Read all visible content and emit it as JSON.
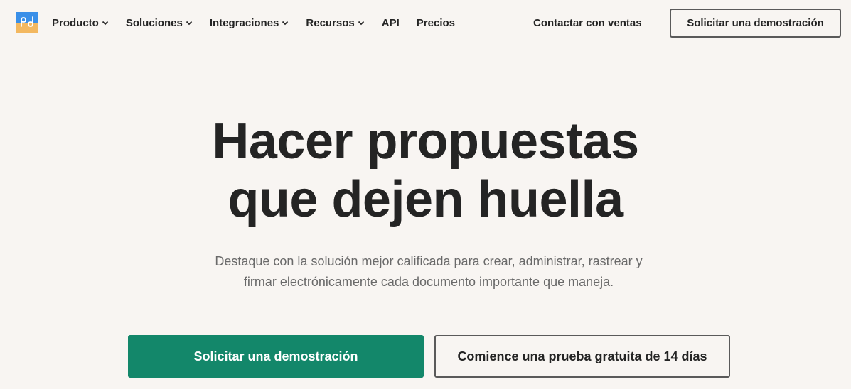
{
  "header": {
    "logo_icon": "pandadoc-logo",
    "nav": [
      {
        "label": "Producto",
        "dropdown": true
      },
      {
        "label": "Soluciones",
        "dropdown": true
      },
      {
        "label": "Integraciones",
        "dropdown": true
      },
      {
        "label": "Recursos",
        "dropdown": true
      },
      {
        "label": "API",
        "dropdown": false
      },
      {
        "label": "Precios",
        "dropdown": false
      }
    ],
    "contact_label": "Contactar con ventas",
    "demo_button_label": "Solicitar una demostración"
  },
  "hero": {
    "title_line1": "Hacer propuestas",
    "title_line2": "que dejen huella",
    "subtitle": "Destaque con la solución mejor calificada para crear, administrar, rastrear y firmar electrónicamente cada documento importante que maneja.",
    "primary_button_label": "Solicitar una demostración",
    "secondary_button_label": "Comience una prueba gratuita de 14 días"
  },
  "colors": {
    "background": "#f8f5f2",
    "primary": "#13876a",
    "text": "#242424",
    "muted": "#6a6a6a",
    "logo_blue": "#3a8fe8",
    "logo_orange": "#f3b860"
  }
}
